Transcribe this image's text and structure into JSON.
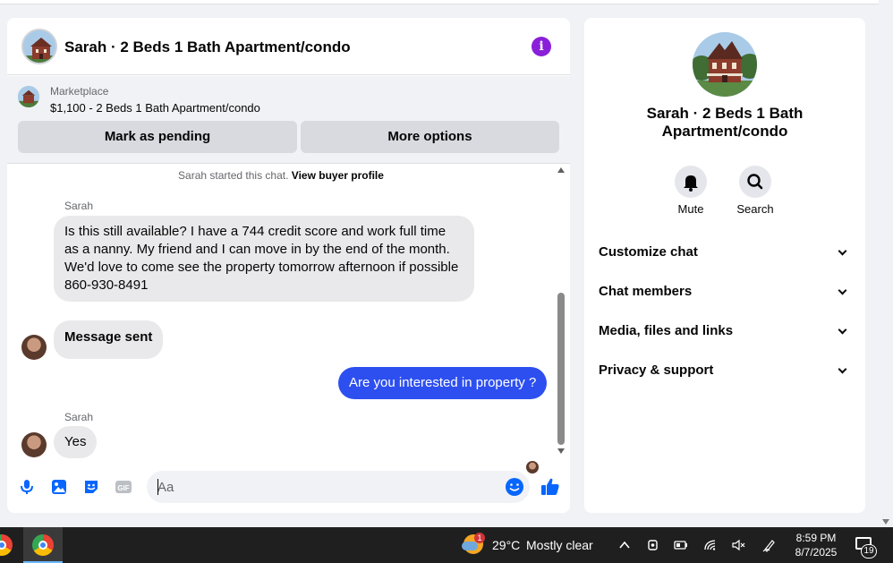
{
  "chat": {
    "title": "Sarah · 2 Beds 1 Bath Apartment/condo",
    "marketplace_label": "Marketplace",
    "listing": "$1,100 - 2 Beds 1 Bath Apartment/condo",
    "mark_pending_label": "Mark as pending",
    "more_options_label": "More options",
    "started_text": "Sarah started this chat.",
    "view_buyer_profile": "View buyer profile",
    "messages": [
      {
        "sender": "Sarah",
        "text": "Is this still available? I have a 744 credit score and work full time as a nanny. My friend and I can move in by the end of the month. We'd love to come see the property tomorrow afternoon if possible 860-930-8491",
        "direction": "in"
      },
      {
        "sender": "",
        "text": "Message sent",
        "direction": "in"
      },
      {
        "sender": "",
        "text": "Are you interested in property ?",
        "direction": "out"
      },
      {
        "sender": "Sarah",
        "text": "Yes",
        "direction": "in"
      }
    ],
    "composer_placeholder": "Aa"
  },
  "info_panel": {
    "title": "Sarah · 2 Beds 1 Bath Apartment/condo",
    "mute_label": "Mute",
    "search_label": "Search",
    "sections": [
      "Customize chat",
      "Chat members",
      "Media, files and links",
      "Privacy & support"
    ]
  },
  "taskbar": {
    "weather_badge": "1",
    "temperature": "29°C",
    "weather": "Mostly clear",
    "time": "8:59 PM",
    "date": "8/7/2025",
    "notification_count": "19"
  },
  "colors": {
    "accent": "#0866ff",
    "outgoing_bubble": "#2d4ff0",
    "info_icon": "#8a1fd9"
  }
}
